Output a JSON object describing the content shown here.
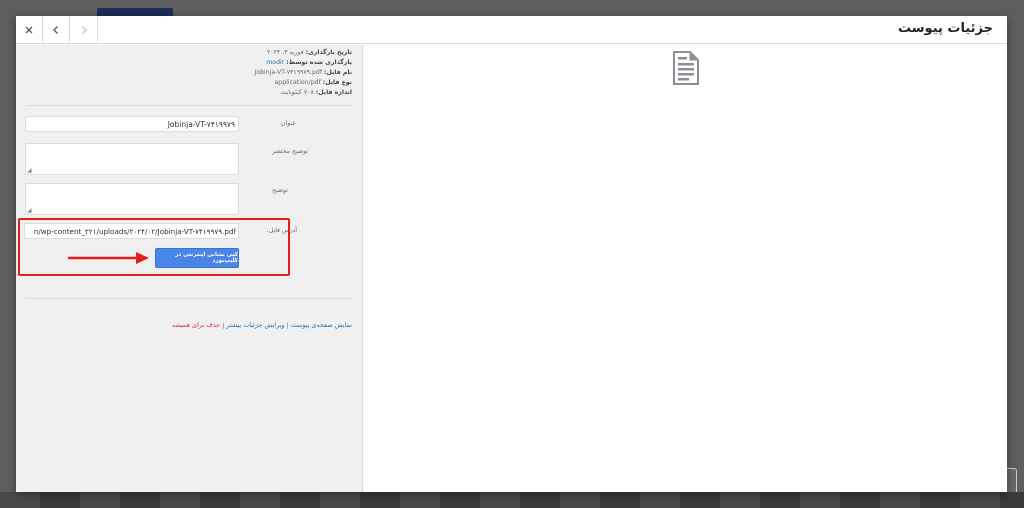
{
  "modal": {
    "title": "جزئیات پیوست"
  },
  "meta": {
    "upload_date_label": "تاریخ بارگذاری:",
    "upload_date_value": "فوریه ۳, ۲۰۲۴",
    "uploaded_by_label": "بارگذاری شده توسط:",
    "uploaded_by_value": "modir",
    "file_name_label": "نام فایل:",
    "file_name_value": "Jobinja-VT-۷۴۱۹۹۷۹.pdf",
    "file_type_label": "نوع فایل:",
    "file_type_value": "application/pdf",
    "file_size_label": "اندازه فایل:",
    "file_size_value": "۷۰۸ کیلوبایت"
  },
  "fields": {
    "title_label": "عنوان",
    "title_value": "Jobinja-VT-۷۴۱۹۹۷۹",
    "caption_label": "توضیح مختصر",
    "description_label": "توضیح",
    "url_label": "آدرس فایل:",
    "url_value": "n/wp-content_۲۲۱/uploads/۲۰۲۴/۰۲/Jobinja-VT-۷۴۱۹۹۷۹.pdf",
    "copy_button_label": "کپی نشانی اینترنتی در کلیپ‌بورد"
  },
  "actions": {
    "view_page": "نمایش صفحه‌ی پیوست",
    "edit_more": "ویرایش جزئیات بیشتر",
    "delete": "حذف برای همیشه",
    "separator": "|"
  },
  "colors": {
    "accent": "#4a86e8",
    "link": "#2271b1",
    "highlight": "#e41e1e"
  },
  "icons": {
    "close": "close-icon",
    "prev": "chevron-left-icon",
    "next": "chevron-right-icon",
    "document": "document-icon"
  }
}
